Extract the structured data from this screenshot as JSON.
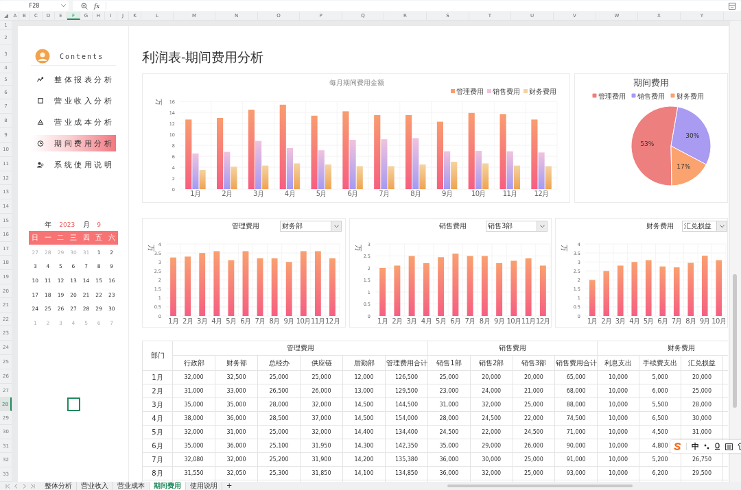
{
  "toolbar": {
    "name_box": "F28",
    "fx_label": "fx"
  },
  "column_headers": [
    {
      "label": "A",
      "selected": false
    },
    {
      "label": "B",
      "selected": false
    },
    {
      "label": "C",
      "selected": false
    },
    {
      "label": "D",
      "selected": false
    },
    {
      "label": "E",
      "selected": false
    },
    {
      "label": "F",
      "selected": true
    },
    {
      "label": "G",
      "selected": false
    },
    {
      "label": "H",
      "selected": false
    },
    {
      "label": "I",
      "selected": false
    },
    {
      "label": "J",
      "selected": false
    },
    {
      "label": "K",
      "selected": false
    },
    {
      "label": "L",
      "selected": false
    },
    {
      "label": "M",
      "selected": false
    },
    {
      "label": "N",
      "selected": false
    },
    {
      "label": "O",
      "selected": false
    },
    {
      "label": "P",
      "selected": false
    },
    {
      "label": "Q",
      "selected": false
    },
    {
      "label": "R",
      "selected": false
    },
    {
      "label": "S",
      "selected": false
    },
    {
      "label": "T",
      "selected": false
    },
    {
      "label": "U",
      "selected": false
    },
    {
      "label": "V",
      "selected": false
    },
    {
      "label": "W",
      "selected": false
    },
    {
      "label": "X",
      "selected": false
    },
    {
      "label": "Y",
      "selected": false
    }
  ],
  "row_headers": [
    {
      "label": "1",
      "selected": false
    },
    {
      "label": "2",
      "selected": false
    },
    {
      "label": "3",
      "selected": false
    },
    {
      "label": "4",
      "selected": false
    },
    {
      "label": "5",
      "selected": false
    },
    {
      "label": "6",
      "selected": false
    },
    {
      "label": "7",
      "selected": false
    },
    {
      "label": "8",
      "selected": false
    },
    {
      "label": "9",
      "selected": false
    },
    {
      "label": "10",
      "selected": false
    },
    {
      "label": "11",
      "selected": false
    },
    {
      "label": "12",
      "selected": false
    },
    {
      "label": "13",
      "selected": false
    },
    {
      "label": "14",
      "selected": false
    },
    {
      "label": "15",
      "selected": false
    },
    {
      "label": "16",
      "selected": false
    },
    {
      "label": "17",
      "selected": false
    },
    {
      "label": "18",
      "selected": false
    },
    {
      "label": "19",
      "selected": false
    },
    {
      "label": "20",
      "selected": false
    },
    {
      "label": "21",
      "selected": false
    },
    {
      "label": "22",
      "selected": false
    },
    {
      "label": "23",
      "selected": false
    },
    {
      "label": "24",
      "selected": false
    },
    {
      "label": "25",
      "selected": false
    },
    {
      "label": "26",
      "selected": false
    },
    {
      "label": "27",
      "selected": false
    },
    {
      "label": "28",
      "selected": true
    },
    {
      "label": "29",
      "selected": false
    },
    {
      "label": "30",
      "selected": false
    },
    {
      "label": "31",
      "selected": false
    },
    {
      "label": "32",
      "selected": false
    },
    {
      "label": "33",
      "selected": false
    }
  ],
  "sidebar": {
    "heading": "Contents",
    "menu": [
      {
        "label": "整体报表分析",
        "selected": false
      },
      {
        "label": "营业收入分析",
        "selected": false
      },
      {
        "label": "营业成本分析",
        "selected": false
      },
      {
        "label": "期间费用分析",
        "selected": true
      },
      {
        "label": "系统使用说明",
        "selected": false
      }
    ]
  },
  "calendar": {
    "year_label": "年",
    "year": "2023",
    "month_label": "月",
    "month": "9",
    "weekdays": [
      "日",
      "一",
      "二",
      "三",
      "四",
      "五",
      "六"
    ],
    "weeks": [
      [
        {
          "day": "27",
          "other_month": true
        },
        {
          "day": "28",
          "other_month": true
        },
        {
          "day": "29",
          "other_month": true
        },
        {
          "day": "30",
          "other_month": true
        },
        {
          "day": "31",
          "other_month": true
        },
        {
          "day": "1",
          "other_month": false
        },
        {
          "day": "2",
          "other_month": false
        }
      ],
      [
        {
          "day": "3",
          "other_month": false
        },
        {
          "day": "4",
          "other_month": false
        },
        {
          "day": "5",
          "other_month": false
        },
        {
          "day": "6",
          "other_month": false
        },
        {
          "day": "7",
          "other_month": false
        },
        {
          "day": "8",
          "other_month": false
        },
        {
          "day": "9",
          "other_month": false
        }
      ],
      [
        {
          "day": "10",
          "other_month": false
        },
        {
          "day": "11",
          "other_month": false
        },
        {
          "day": "12",
          "other_month": false
        },
        {
          "day": "13",
          "other_month": false
        },
        {
          "day": "14",
          "other_month": false
        },
        {
          "day": "15",
          "other_month": false
        },
        {
          "day": "16",
          "other_month": false
        }
      ],
      [
        {
          "day": "17",
          "other_month": false
        },
        {
          "day": "18",
          "other_month": false
        },
        {
          "day": "19",
          "other_month": false
        },
        {
          "day": "20",
          "other_month": false
        },
        {
          "day": "21",
          "other_month": false
        },
        {
          "day": "22",
          "other_month": false
        },
        {
          "day": "23",
          "other_month": false
        }
      ],
      [
        {
          "day": "24",
          "other_month": false
        },
        {
          "day": "25",
          "other_month": false
        },
        {
          "day": "26",
          "other_month": false
        },
        {
          "day": "27",
          "other_month": false
        },
        {
          "day": "28",
          "other_month": false
        },
        {
          "day": "29",
          "other_month": false
        },
        {
          "day": "30",
          "other_month": false
        }
      ],
      [
        {
          "day": "1",
          "other_month": true
        },
        {
          "day": "2",
          "other_month": true
        },
        {
          "day": "3",
          "other_month": true
        },
        {
          "day": "4",
          "other_month": true
        },
        {
          "day": "5",
          "other_month": true
        },
        {
          "day": "6",
          "other_month": true
        },
        {
          "day": "7",
          "other_month": true
        }
      ]
    ]
  },
  "page_title": "利润表-期间费用分析",
  "monthly_chart": {
    "chart_data": {
      "type": "bar",
      "title": "每月期间费用金额",
      "ylabel": "万",
      "categories": [
        "1月",
        "2月",
        "3月",
        "4月",
        "5月",
        "6月",
        "7月",
        "8月",
        "9月",
        "10月",
        "11月",
        "12月"
      ],
      "series": [
        {
          "name": "管理费用",
          "color": "#f99c6f",
          "values": [
            12.7,
            13.0,
            14.5,
            15.4,
            13.4,
            14.2,
            13.5,
            13.5,
            12.3,
            13.9,
            13.7,
            12.7
          ]
        },
        {
          "name": "销售费用",
          "color": "#f1c2dd",
          "values": [
            6.5,
            6.8,
            8.8,
            7.5,
            7.1,
            9.0,
            9.1,
            9.3,
            6.9,
            7.0,
            6.9,
            6.7
          ]
        },
        {
          "name": "财务费用",
          "color": "#f5d3a1",
          "values": [
            3.5,
            4.1,
            4.3,
            4.7,
            4.5,
            4.2,
            4.2,
            4.5,
            5.0,
            4.7,
            4.3,
            4.2
          ]
        }
      ],
      "ylim": [
        0,
        16
      ],
      "yticks": [
        {
          "value": 0,
          "label": "0"
        },
        {
          "value": 2,
          "label": "2"
        },
        {
          "value": 4,
          "label": "4"
        },
        {
          "value": 6,
          "label": "6"
        },
        {
          "value": 8,
          "label": "8"
        },
        {
          "value": 10,
          "label": "10"
        },
        {
          "value": 12,
          "label": "12"
        },
        {
          "value": 14,
          "label": "14"
        },
        {
          "value": 16,
          "label": "16"
        }
      ],
      "grid": true,
      "legend": true
    }
  },
  "pie_chart": {
    "chart_data": {
      "type": "pie",
      "title": "期间费用",
      "categories": [
        "管理费用",
        "销售费用",
        "财务费用"
      ],
      "values": [
        53,
        30,
        17
      ],
      "colors": [
        "#ee7f7f",
        "#a99af2",
        "#fba36f"
      ],
      "value_labels": [
        "53%",
        "30%",
        "17%"
      ],
      "legend": true
    }
  },
  "department_charts": [
    {
      "dropdown": "财务部",
      "chart_data": {
        "type": "bar",
        "title": "管理费用",
        "ylabel": "万",
        "categories": [
          "1月",
          "2月",
          "3月",
          "4月",
          "5月",
          "6月",
          "7月",
          "8月",
          "9月",
          "10月",
          "11月",
          "12月"
        ],
        "series": [
          {
            "color": "#f9a070",
            "values": [
              3.25,
              3.3,
              3.5,
              3.6,
              3.1,
              3.6,
              3.2,
              3.2,
              3.0,
              3.6,
              3.6,
              3.2
            ]
          }
        ],
        "ylim": [
          0,
          4
        ],
        "yticks": [
          {
            "value": 0,
            "label": "0"
          },
          {
            "value": 0.5,
            "label": "0.5"
          },
          {
            "value": 1,
            "label": "1"
          },
          {
            "value": 1.5,
            "label": "1.5"
          },
          {
            "value": 2,
            "label": "2"
          },
          {
            "value": 2.5,
            "label": "2.5"
          },
          {
            "value": 3,
            "label": "3"
          },
          {
            "value": 3.5,
            "label": "3.5"
          },
          {
            "value": 4,
            "label": "4"
          }
        ],
        "grid": true
      }
    },
    {
      "dropdown": "销售3部",
      "chart_data": {
        "type": "bar",
        "title": "销售费用",
        "ylabel": "万",
        "categories": [
          "1月",
          "2月",
          "3月",
          "4月",
          "5月",
          "6月",
          "7月",
          "8月",
          "9月",
          "10月",
          "11月",
          "12月"
        ],
        "series": [
          {
            "color": "#f9a070",
            "values": [
              2.0,
              2.1,
              2.5,
              2.2,
              2.45,
              2.6,
              2.5,
              2.5,
              2.2,
              2.3,
              2.4,
              2.1
            ]
          }
        ],
        "ylim": [
          0,
          3
        ],
        "yticks": [
          {
            "value": 0,
            "label": "0"
          },
          {
            "value": 0.5,
            "label": "0.5"
          },
          {
            "value": 1,
            "label": "1"
          },
          {
            "value": 1.5,
            "label": "1.5"
          },
          {
            "value": 2,
            "label": "2"
          },
          {
            "value": 2.5,
            "label": "2.5"
          },
          {
            "value": 3,
            "label": "3"
          }
        ],
        "grid": true
      }
    },
    {
      "dropdown": "汇兑损益",
      "chart_data": {
        "type": "bar",
        "title": "财务费用",
        "ylabel": "万",
        "categories": [
          "1月",
          "2月",
          "3月",
          "4月",
          "5月",
          "6月",
          "7月",
          "8月",
          "9月",
          "10月"
        ],
        "series": [
          {
            "color": "#f9a070",
            "values": [
              2.0,
              2.5,
              2.8,
              3.0,
              3.1,
              2.75,
              2.7,
              2.95,
              3.35,
              3.1
            ]
          }
        ],
        "ylim": [
          0,
          4
        ],
        "yticks": [
          {
            "value": 0,
            "label": "0"
          },
          {
            "value": 0.5,
            "label": "0.5"
          },
          {
            "value": 1,
            "label": "1"
          },
          {
            "value": 1.5,
            "label": "1.5"
          },
          {
            "value": 2,
            "label": "2"
          },
          {
            "value": 2.5,
            "label": "2.5"
          },
          {
            "value": 3,
            "label": "3"
          },
          {
            "value": 3.5,
            "label": "3.5"
          },
          {
            "value": 4,
            "label": "4"
          }
        ],
        "grid": true
      }
    }
  ],
  "table": {
    "corner": "部门",
    "groups": [
      {
        "label": "管理费用",
        "columns": [
          "行政部",
          "财务部",
          "总经办",
          "供应链",
          "后勤部",
          "管理费用合计"
        ]
      },
      {
        "label": "销售费用",
        "columns": [
          "销售1部",
          "销售2部",
          "销售3部",
          "销售费用合计"
        ]
      },
      {
        "label": "财务费用",
        "columns": [
          "利息支出",
          "手续费支出",
          "汇兑损益"
        ]
      }
    ],
    "rows": [
      {
        "label": "1月",
        "cells": [
          "32,000",
          "32,500",
          "25,000",
          "25,000",
          "12,000",
          "126,500",
          "25,000",
          "20,000",
          "20,000",
          "65,000",
          "10,000",
          "5,000",
          "20,000"
        ]
      },
      {
        "label": "2月",
        "cells": [
          "31,000",
          "33,000",
          "26,500",
          "26,000",
          "13,000",
          "129,500",
          "23,000",
          "24,000",
          "21,000",
          "68,000",
          "10,000",
          "6,000",
          "25,000"
        ]
      },
      {
        "label": "3月",
        "cells": [
          "35,000",
          "35,000",
          "28,000",
          "32,000",
          "14,500",
          "144,500",
          "31,000",
          "32,000",
          "25,000",
          "88,000",
          "10,000",
          "5,500",
          "28,000"
        ]
      },
      {
        "label": "4月",
        "cells": [
          "38,000",
          "36,000",
          "28,500",
          "37,000",
          "14,500",
          "154,000",
          "28,000",
          "24,500",
          "22,000",
          "74,500",
          "10,000",
          "6,500",
          "30,000"
        ]
      },
      {
        "label": "5月",
        "cells": [
          "32,000",
          "31,000",
          "25,000",
          "32,000",
          "14,400",
          "134,400",
          "24,500",
          "22,000",
          "24,500",
          "71,000",
          "10,000",
          "4,500",
          "31,000"
        ]
      },
      {
        "label": "6月",
        "cells": [
          "35,000",
          "36,000",
          "25,100",
          "31,950",
          "14,300",
          "142,350",
          "35,000",
          "29,000",
          "26,000",
          "90,000",
          "10,000",
          "4,800"
        ]
      },
      {
        "label": "7月",
        "cells": [
          "32,080",
          "32,000",
          "25,200",
          "31,900",
          "14,200",
          "135,380",
          "36,000",
          "30,000",
          "25,000",
          "91,000",
          "10,000",
          "5,200",
          "26,750"
        ]
      },
      {
        "label": "8月",
        "cells": [
          "31,550",
          "32,050",
          "25,300",
          "31,850",
          "14,100",
          "134,850",
          "36,000",
          "32,000",
          "25,000",
          "93,000",
          "10,000",
          "6,200",
          "29,500"
        ]
      }
    ]
  },
  "ime_toolbar": {
    "mode": "中"
  },
  "sheet_tabs": [
    {
      "label": "整体分析",
      "selected": false
    },
    {
      "label": "营业收入",
      "selected": false
    },
    {
      "label": "营业成本",
      "selected": false
    },
    {
      "label": "期间费用",
      "selected": true
    },
    {
      "label": "使用说明",
      "selected": false
    }
  ],
  "add_sheet": "+"
}
